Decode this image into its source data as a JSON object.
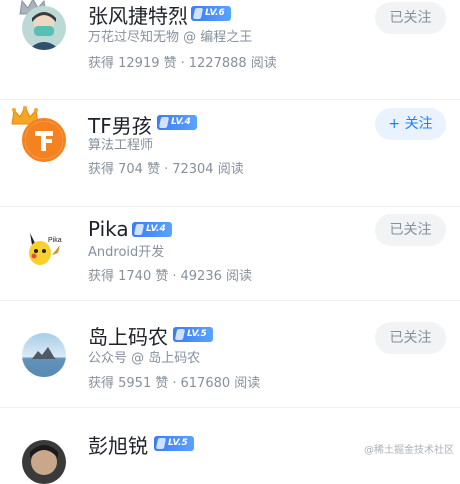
{
  "users": [
    {
      "name": "张风捷特烈",
      "level": "LV.6",
      "subtitle": "万花过尽知无物 @ 编程之王",
      "likes": "获得 12919 赞",
      "reads": "1227888 阅读",
      "follow_label": "已关注",
      "followed": true
    },
    {
      "name": "TF男孩",
      "level": "LV.4",
      "subtitle": "算法工程师",
      "likes": "获得 704 赞",
      "reads": "72304 阅读",
      "follow_label": "+ 关注",
      "followed": false
    },
    {
      "name": "Pika",
      "level": "LV.4",
      "subtitle": "Android开发",
      "likes": "获得 1740 赞",
      "reads": "49236 阅读",
      "follow_label": "已关注",
      "followed": true
    },
    {
      "name": "岛上码农",
      "level": "LV.5",
      "subtitle": "公众号 @ 岛上码农",
      "likes": "获得 5951 赞",
      "reads": "617680 阅读",
      "follow_label": "已关注",
      "followed": true
    },
    {
      "name": "彭旭锐",
      "level": "LV.5"
    }
  ],
  "separator": "·",
  "avatar_text": "Pika",
  "watermark": "@稀土掘金技术社区",
  "colors": {
    "accent": "#1e80ff",
    "badge": "#3b7cf6",
    "crown_gray": "#9aa3ad",
    "crown_orange": "#f5a623"
  }
}
